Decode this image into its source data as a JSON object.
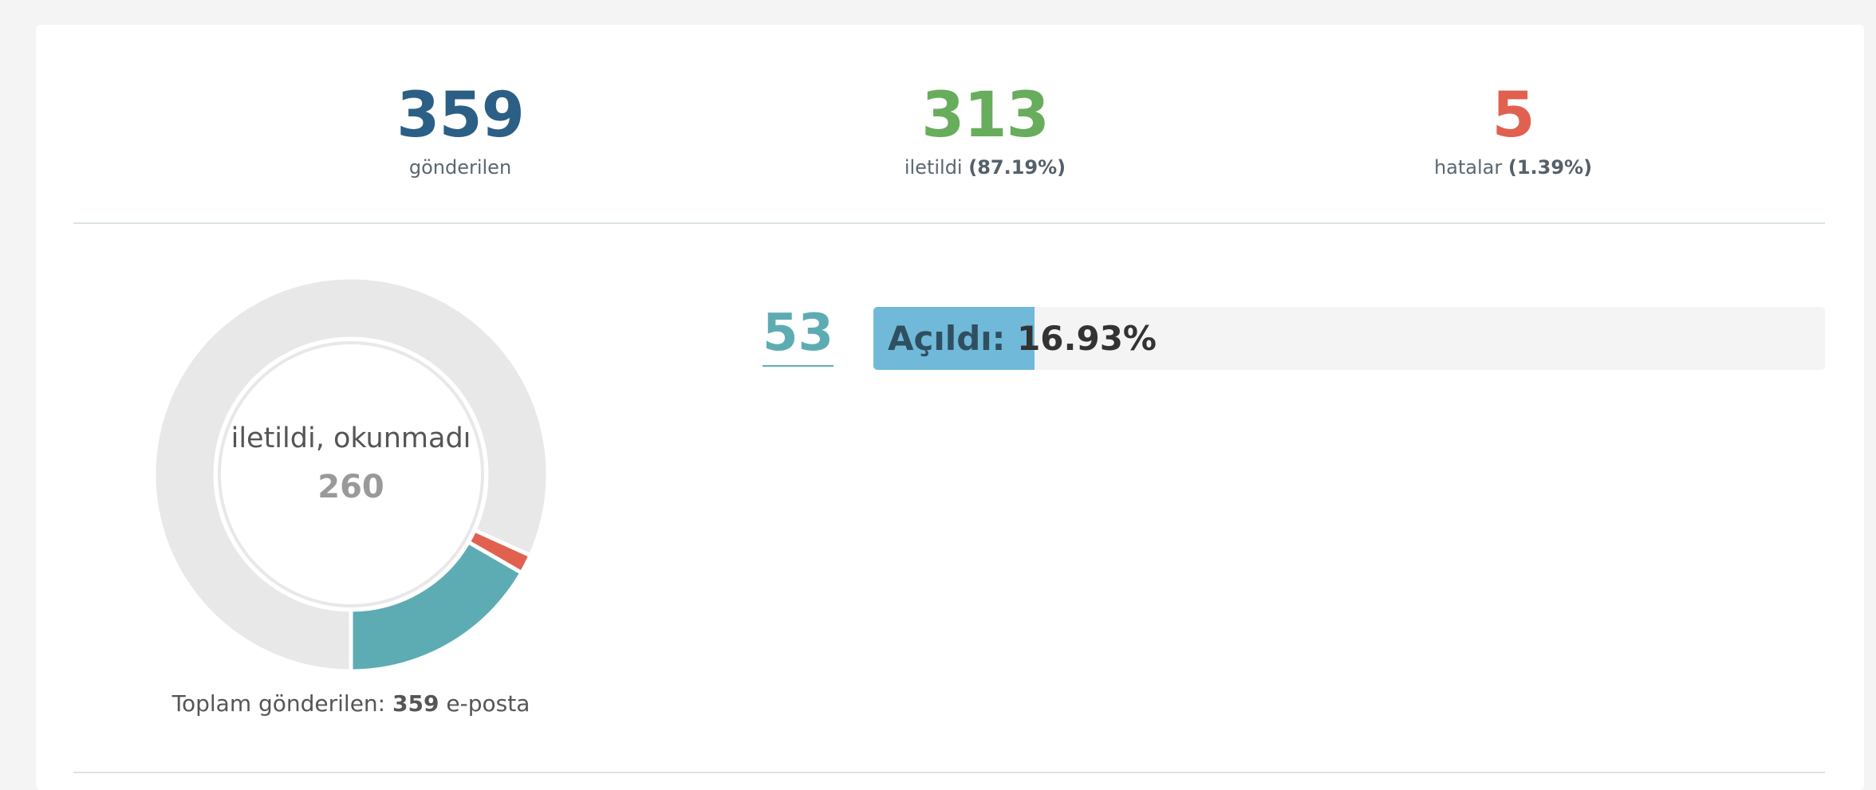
{
  "stats": {
    "sent": {
      "value": "359",
      "label": "gönderilen",
      "color": "#2b5f85"
    },
    "delivered": {
      "value": "313",
      "label": "iletildi",
      "pct": "(87.19%)",
      "color": "#67ad5c"
    },
    "errors": {
      "value": "5",
      "label": "hatalar",
      "pct": "(1.39%)",
      "color": "#e0614f"
    }
  },
  "chart_data": {
    "type": "pie",
    "variant": "donut",
    "series": [
      {
        "name": "iletildi, okunmadı",
        "value": 260,
        "color": "#e8e8e8"
      },
      {
        "value": 5,
        "color": "#e0614f"
      },
      {
        "value": 53,
        "color": "#5dacb3"
      }
    ],
    "center_label": "iletildi, okunmadı",
    "center_value": "260"
  },
  "total": {
    "prefix": "Toplam gönderilen:",
    "value": "359",
    "suffix": "e-posta"
  },
  "opened": {
    "count": "53",
    "label": "Açıldı:",
    "pct_text": "16.93%",
    "fraction": 0.1693,
    "bar_color": "#70b9d9"
  }
}
